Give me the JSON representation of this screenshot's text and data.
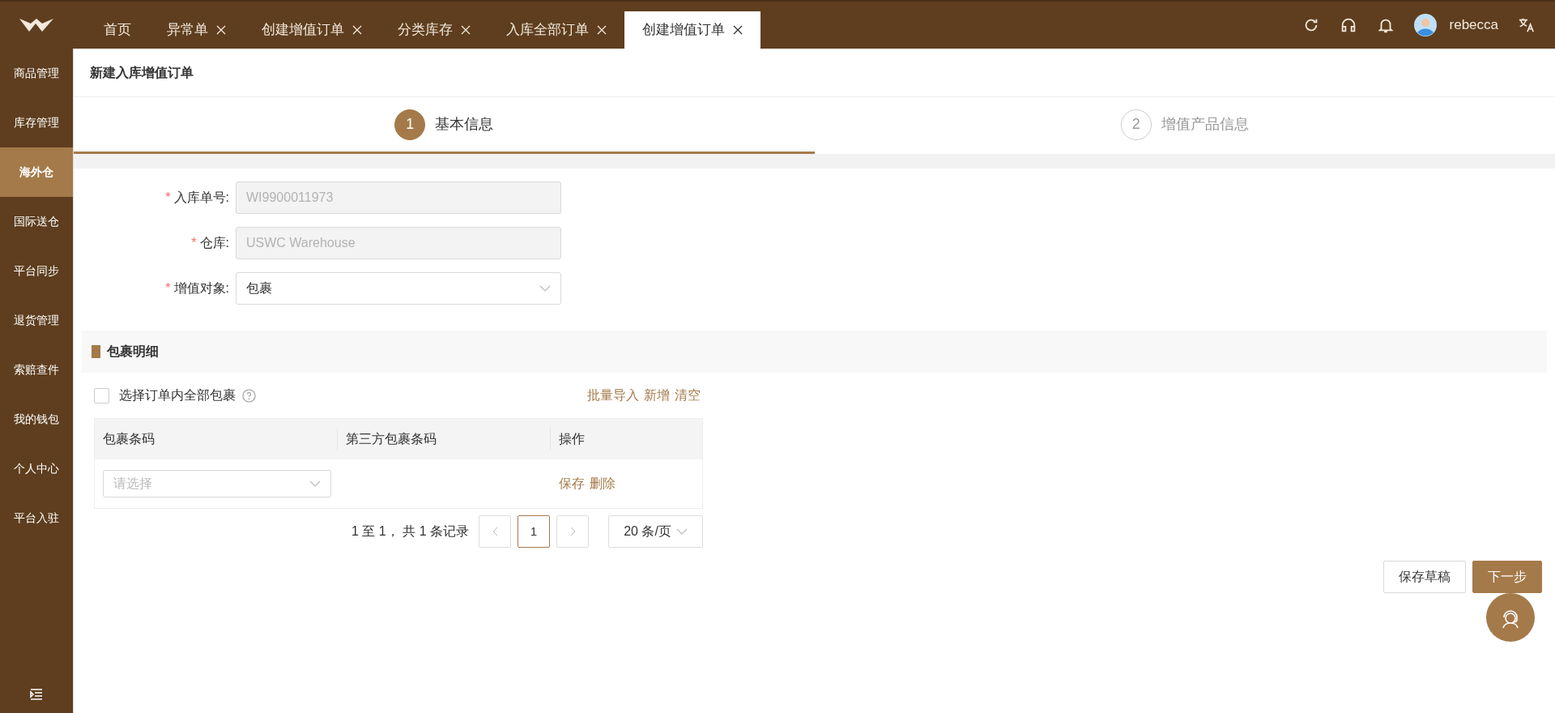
{
  "tabs": [
    {
      "label": "首页",
      "closable": false,
      "selected": false
    },
    {
      "label": "异常单",
      "closable": true,
      "selected": false
    },
    {
      "label": "创建增值订单",
      "closable": true,
      "selected": false
    },
    {
      "label": "分类库存",
      "closable": true,
      "selected": false
    },
    {
      "label": "入库全部订单",
      "closable": true,
      "selected": false
    },
    {
      "label": "创建增值订单",
      "closable": true,
      "selected": true
    }
  ],
  "user": {
    "name": "rebecca"
  },
  "sidebar": {
    "items": [
      {
        "label": "商品管理",
        "selected": false
      },
      {
        "label": "库存管理",
        "selected": false
      },
      {
        "label": "海外仓",
        "selected": true
      },
      {
        "label": "国际送仓",
        "selected": false
      },
      {
        "label": "平台同步",
        "selected": false
      },
      {
        "label": "退货管理",
        "selected": false
      },
      {
        "label": "索赔查件",
        "selected": false
      },
      {
        "label": "我的钱包",
        "selected": false
      },
      {
        "label": "个人中心",
        "selected": false
      },
      {
        "label": "平台入驻",
        "selected": false
      }
    ]
  },
  "page_title": "新建入库增值订单",
  "steps": [
    {
      "number": "1",
      "label": "基本信息",
      "selected": true
    },
    {
      "number": "2",
      "label": "增值产品信息",
      "selected": false
    }
  ],
  "form": {
    "fields": [
      {
        "label": "入库单号:",
        "required_mark": "*",
        "kind": "input",
        "value": "WI9900011973",
        "disabled": true
      },
      {
        "label": "仓库:",
        "required_mark": "*",
        "kind": "input",
        "value": "USWC Warehouse",
        "disabled": true
      },
      {
        "label": "增值对象:",
        "required_mark": "*",
        "kind": "select",
        "value": "包裹",
        "disabled": false
      }
    ]
  },
  "section": {
    "title": "包裹明细",
    "select_all": {
      "label": "选择订单内全部包裹",
      "checked": false
    },
    "actions": [
      "批量导入",
      "新增",
      "清空"
    ],
    "table": {
      "columns": [
        "包裹条码",
        "第三方包裹条码",
        "操作"
      ],
      "rows": [
        {
          "barcode_placeholder": "请选择",
          "actions": [
            "保存",
            "删除"
          ]
        }
      ]
    },
    "pagination": {
      "summary": "1 至 1， 共 1 条记录",
      "pages": [
        {
          "label": "1",
          "selected": true
        }
      ],
      "page_size": "20 条/页"
    }
  },
  "buttons": [
    {
      "label": "保存草稿",
      "kind": "secondary"
    },
    {
      "label": "下一步",
      "kind": "primary"
    }
  ]
}
